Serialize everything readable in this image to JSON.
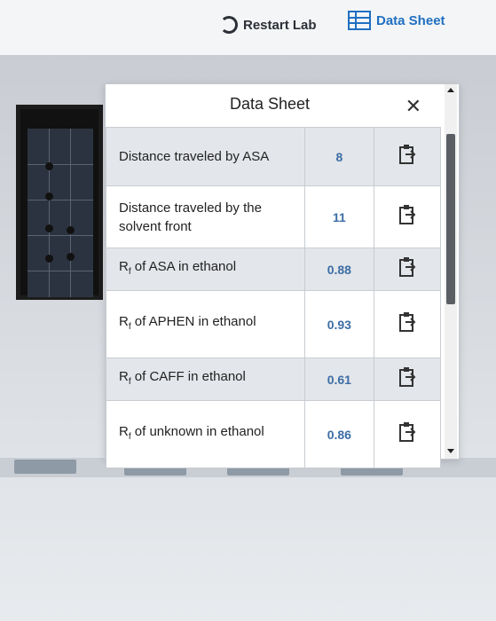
{
  "toolbar": {
    "restart_label": "Restart Lab",
    "datasheet_label": "Data Sheet"
  },
  "panel": {
    "title": "Data Sheet",
    "close_glyph": "✕",
    "rows": [
      {
        "label": "Distance traveled by ASA",
        "value": "8"
      },
      {
        "label": "Distance traveled by the solvent front",
        "value": "11"
      },
      {
        "label_main": "R",
        "label_sub": "f",
        "label_rest": " of ASA in ethanol",
        "value": "0.88"
      },
      {
        "label_main": "R",
        "label_sub": "f",
        "label_rest": " of APHEN in ethanol",
        "value": "0.93"
      },
      {
        "label_main": "R",
        "label_sub": "f",
        "label_rest": " of CAFF in ethanol",
        "value": "0.61"
      },
      {
        "label_main": "R",
        "label_sub": "f",
        "label_rest": " of unknown in ethanol",
        "value": "0.86"
      }
    ]
  },
  "colors": {
    "accent": "#1f6fc1",
    "value_text": "#3d6da5"
  },
  "icons": {
    "restart": "restart-icon",
    "datasheet": "table-icon",
    "copy": "clipboard-icon"
  }
}
